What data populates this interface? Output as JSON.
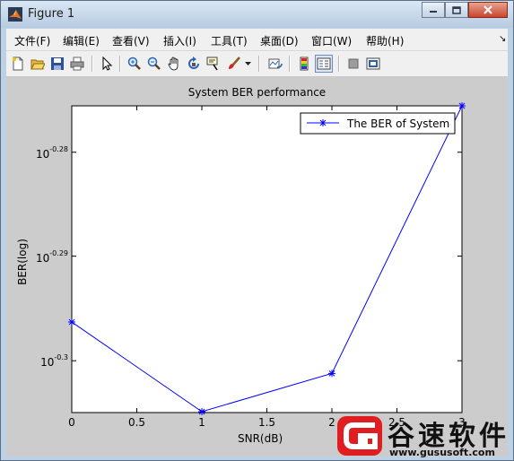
{
  "window": {
    "title": "Figure 1",
    "buttons": {
      "minimize_icon": "minimize-icon",
      "maximize_icon": "maximize-icon",
      "close_icon": "close-icon"
    }
  },
  "menubar": {
    "items": [
      {
        "label": "文件(F)"
      },
      {
        "label": "编辑(E)"
      },
      {
        "label": "查看(V)"
      },
      {
        "label": "插入(I)"
      },
      {
        "label": "工具(T)"
      },
      {
        "label": "桌面(D)"
      },
      {
        "label": "窗口(W)"
      },
      {
        "label": "帮助(H)"
      }
    ],
    "dock_arrow": "↘"
  },
  "toolbar": {
    "buttons": [
      {
        "icon": "new-figure-icon"
      },
      {
        "icon": "open-file-icon"
      },
      {
        "icon": "save-icon"
      },
      {
        "icon": "print-icon"
      },
      {
        "icon": "edit-plot-icon"
      },
      {
        "icon": "zoom-in-icon"
      },
      {
        "icon": "zoom-out-icon"
      },
      {
        "icon": "pan-icon"
      },
      {
        "icon": "rotate-3d-icon"
      },
      {
        "icon": "data-cursor-icon"
      },
      {
        "icon": "brush-icon"
      },
      {
        "icon": "link-plot-icon"
      },
      {
        "icon": "insert-colorbar-icon"
      },
      {
        "icon": "insert-legend-icon"
      },
      {
        "icon": "hide-plot-tools-icon"
      },
      {
        "icon": "show-plot-tools-icon"
      }
    ],
    "active": "insert-legend-icon"
  },
  "chart_data": {
    "type": "line",
    "title": "System BER performance",
    "xlabel": "SNR(dB)",
    "ylabel": "BER(log)",
    "y_scale": "log",
    "x": [
      0,
      1,
      2,
      3
    ],
    "series": [
      {
        "name": "The BER of System",
        "values": [
          0.5055,
          0.4956,
          0.4998,
          0.5302
        ],
        "color": "#0000ff",
        "marker": "asterisk"
      }
    ],
    "xlim": [
      0,
      3
    ],
    "ylim": [
      0.4955,
      0.5302
    ],
    "xticks": [
      "0",
      "0.5",
      "1",
      "1.5",
      "2",
      "2.5",
      "3"
    ],
    "yticks": [
      {
        "value": 0.5248,
        "base": "10",
        "exp": "-0.28"
      },
      {
        "value": 0.5129,
        "base": "10",
        "exp": "-0.29"
      },
      {
        "value": 0.5012,
        "base": "10",
        "exp": "-0.3"
      }
    ],
    "grid": false,
    "legend": "top-right"
  },
  "watermark": {
    "text": "谷速软件",
    "url": "www.gususoft.com",
    "brand_color": "#e01e22"
  }
}
